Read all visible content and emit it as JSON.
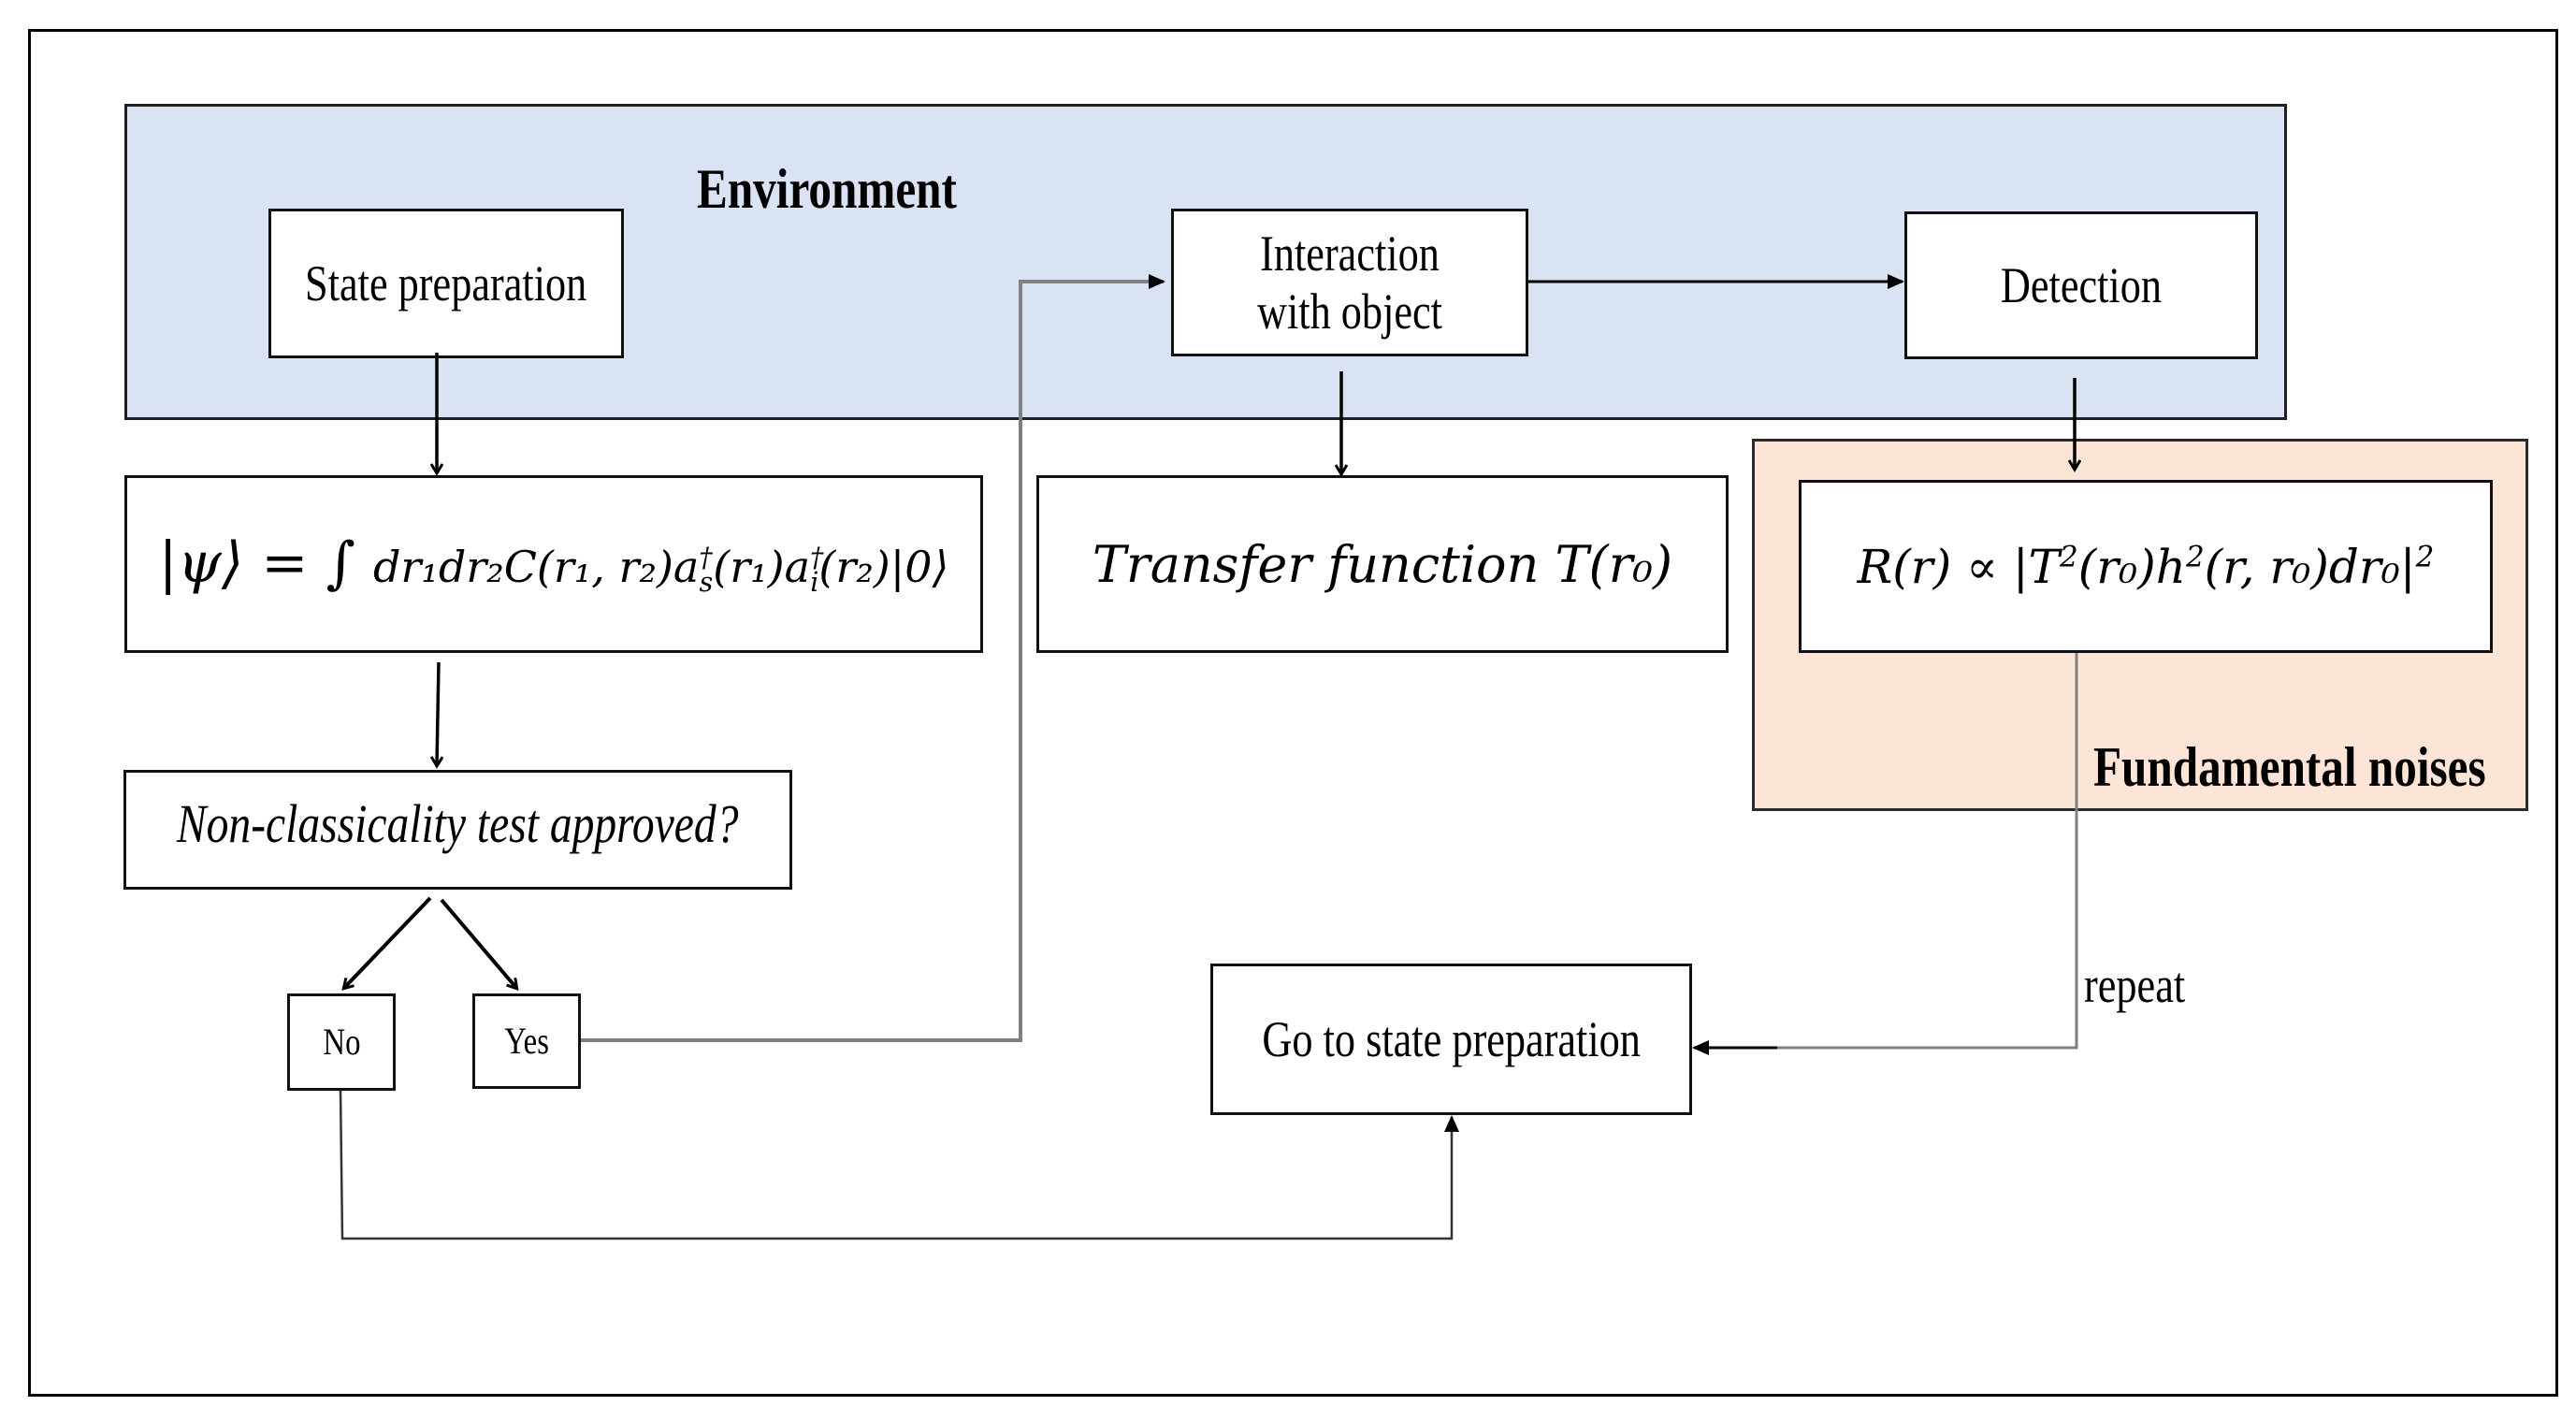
{
  "diagram": {
    "regions": {
      "environment": {
        "label": "Environment",
        "fill": "#DAE3F3"
      },
      "fundamental_noises": {
        "label": "Fundamental noises",
        "fill": "#FCE4D6"
      }
    },
    "nodes": {
      "state_preparation": "State preparation",
      "interaction": "Interaction with object",
      "detection": "Detection",
      "state_equation": {
        "lhs": "|ψ⟩ = ∫ ",
        "body": "dr₁dr₂C(r₁, r₂)a",
        "s_sup": "†",
        "s_sub": "s",
        "mid": "(r₁)a",
        "i_sup": "†",
        "i_sub": "i",
        "tail": "(r₂)|0⟩"
      },
      "transfer_function": "Transfer function T(r₀)",
      "response": {
        "text_a": "R(r) ∝ |T",
        "sup1": "2",
        "text_b": "(r₀)h",
        "sup2": "2",
        "text_c": "(r, r₀)dr₀|",
        "sup3": "2"
      },
      "non_classicality": "Non-classicality test approved?",
      "no": "No",
      "yes": "Yes",
      "go_to_state_preparation": "Go to state preparation"
    },
    "edge_labels": {
      "repeat": "repeat"
    },
    "edges": [
      {
        "from": "state_preparation",
        "to": "state_equation"
      },
      {
        "from": "state_equation",
        "to": "non_classicality"
      },
      {
        "from": "non_classicality",
        "to": "no"
      },
      {
        "from": "non_classicality",
        "to": "yes"
      },
      {
        "from": "yes",
        "to": "interaction"
      },
      {
        "from": "interaction",
        "to": "detection"
      },
      {
        "from": "interaction",
        "to": "transfer_function"
      },
      {
        "from": "detection",
        "to": "response"
      },
      {
        "from": "response",
        "to": "go_to_state_preparation",
        "label": "repeat"
      },
      {
        "from": "no",
        "to": "go_to_state_preparation"
      }
    ]
  }
}
